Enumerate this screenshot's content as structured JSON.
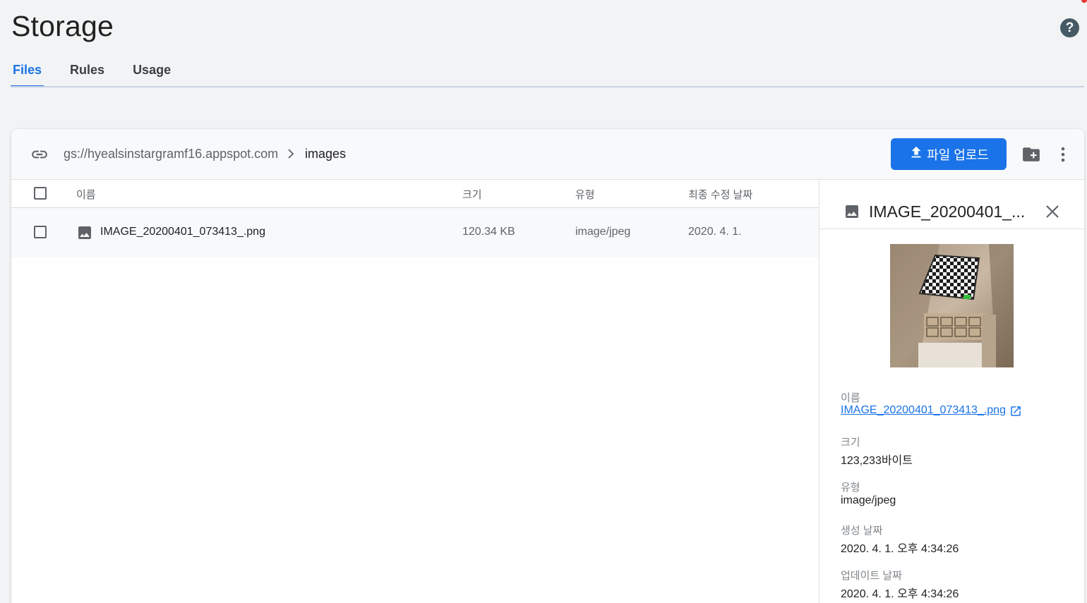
{
  "page": {
    "title": "Storage"
  },
  "tabs": [
    {
      "label": "Files",
      "active": true
    },
    {
      "label": "Rules",
      "active": false
    },
    {
      "label": "Usage",
      "active": false
    }
  ],
  "toolbar": {
    "bucket": "gs://hyealsinstargramf16.appspot.com",
    "folder": "images",
    "upload_label": "파일 업로드"
  },
  "table": {
    "headers": {
      "name": "이름",
      "size": "크기",
      "type": "유형",
      "modified": "최종 수정 날짜"
    },
    "rows": [
      {
        "name": "IMAGE_20200401_073413_.png",
        "size": "120.34 KB",
        "type": "image/jpeg",
        "modified": "2020. 4. 1."
      }
    ]
  },
  "details": {
    "title": "IMAGE_20200401_...",
    "name_label": "이름",
    "name_value": "IMAGE_20200401_073413_.png",
    "size_label": "크기",
    "size_value": "123,233바이트",
    "type_label": "유형",
    "type_value": "image/jpeg",
    "created_label": "생성 날짜",
    "created_value": "2020. 4. 1. 오후 4:34:26",
    "updated_label": "업데이트 날짜",
    "updated_value": "2020. 4. 1. 오후 4:34:26"
  },
  "colors": {
    "accent": "#1a73e8",
    "icon": "#5f6368",
    "help": "#455a64"
  },
  "icons": [
    "help-icon",
    "link-icon",
    "chevron-right-icon",
    "upload-icon",
    "new-folder-icon",
    "more-vert-icon",
    "image-icon",
    "close-icon",
    "open-in-new-icon"
  ]
}
